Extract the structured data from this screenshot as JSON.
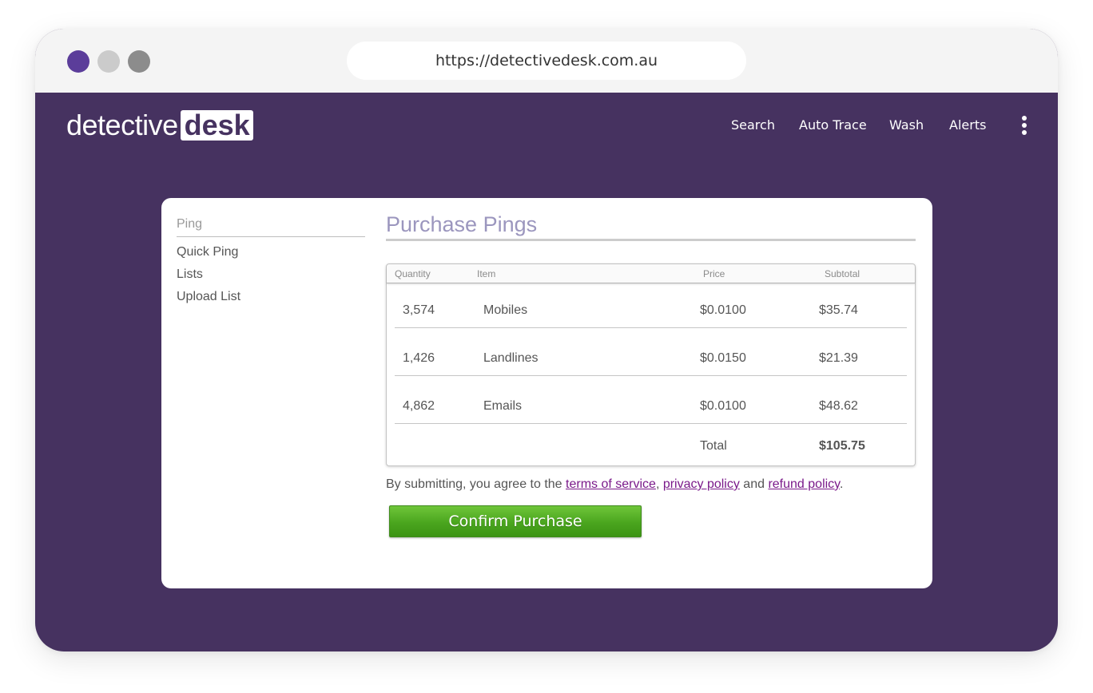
{
  "browser": {
    "url": "https://detectivedesk.com.au",
    "traffic_light_colors": [
      "#5b3d9a",
      "#cbcbcb",
      "#8c8c8c"
    ]
  },
  "brand": {
    "logo_part1": "detective",
    "logo_part2": "desk",
    "primary_color": "#463260"
  },
  "nav": {
    "items": [
      {
        "label": "Search"
      },
      {
        "label": "Auto Trace"
      },
      {
        "label": "Wash"
      },
      {
        "label": "Alerts"
      }
    ],
    "menu_icon": "more-vertical-icon"
  },
  "sidebar": {
    "heading": "Ping",
    "items": [
      {
        "label": "Quick Ping"
      },
      {
        "label": "Lists"
      },
      {
        "label": "Upload List"
      }
    ]
  },
  "purchase": {
    "title": "Purchase Pings",
    "columns": {
      "quantity": "Quantity",
      "item": "Item",
      "price": "Price",
      "subtotal": "Subtotal"
    },
    "rows": [
      {
        "quantity": "3,574",
        "item": "Mobiles",
        "price": "$0.0100",
        "subtotal": "$35.74"
      },
      {
        "quantity": "1,426",
        "item": "Landlines",
        "price": "$0.0150",
        "subtotal": "$21.39"
      },
      {
        "quantity": "4,862",
        "item": "Emails",
        "price": "$0.0100",
        "subtotal": "$48.62"
      }
    ],
    "total_label": "Total",
    "total_value": "$105.75",
    "terms": {
      "prefix": "By submitting, you agree to the ",
      "tos": "terms of service",
      "comma": ", ",
      "privacy": "privacy policy",
      "and": " and ",
      "refund": "refund policy",
      "suffix": "."
    },
    "confirm_button": "Confirm Purchase",
    "confirm_color": "#4aa51e"
  }
}
